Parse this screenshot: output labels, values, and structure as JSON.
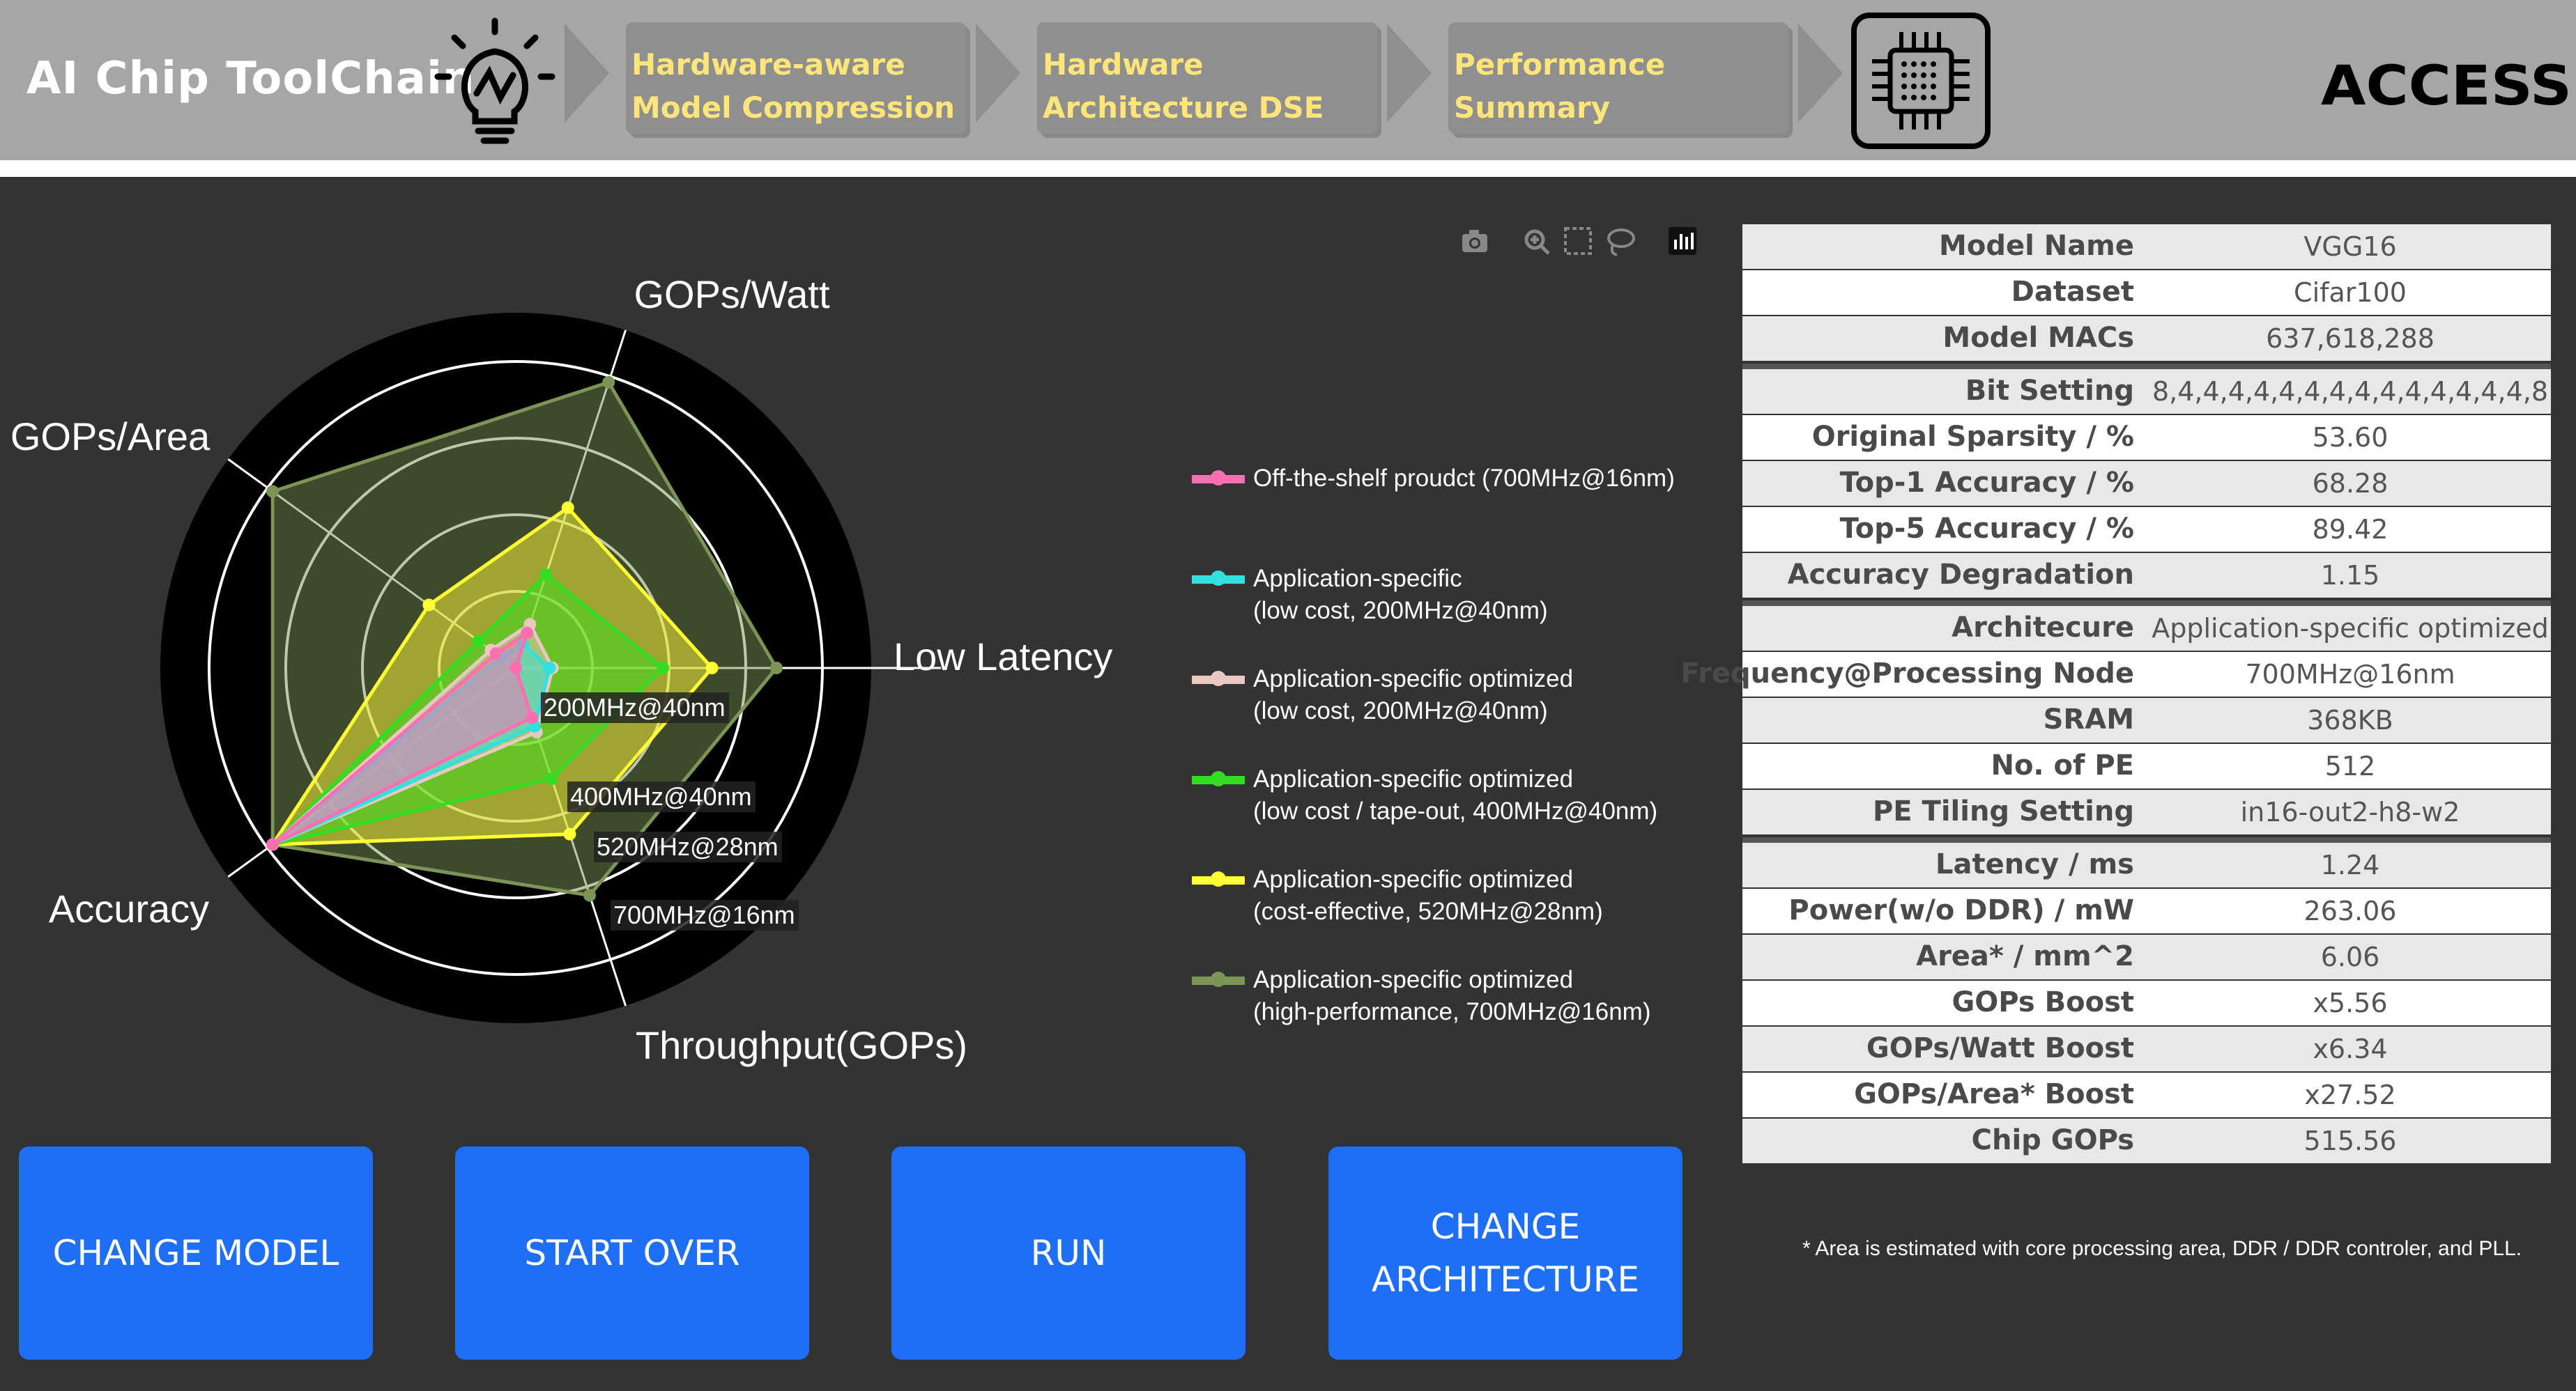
{
  "header": {
    "app_title": "AI Chip ToolChain",
    "steps": [
      {
        "label": "Hardware-aware\nModel Compression"
      },
      {
        "label": "Hardware\nArchitecture DSE"
      },
      {
        "label": "Performance\nSummary"
      }
    ],
    "logo_text": "ACCESS",
    "step_text_color": "#ffe57a"
  },
  "toolbar": {
    "icons": [
      "camera-icon",
      "zoom-icon",
      "box-select-icon",
      "lasso-icon",
      "plotly-logo-icon"
    ]
  },
  "chart_data": {
    "type": "radar",
    "axes": [
      "Low Latency",
      "GOPs/Watt",
      "GOPs/Area",
      "Accuracy",
      "Throughput(GOPs)"
    ],
    "range": [
      0,
      1
    ],
    "grid_levels": [
      0.25,
      0.5,
      0.75,
      1.0
    ],
    "series": [
      {
        "name": "Off-the-shelf proudct (700MHz@16nm)",
        "color": "#ff6fb1",
        "values": [
          0.0,
          0.12,
          0.08,
          0.98,
          0.17
        ]
      },
      {
        "name": "Application-specific\n(low cost, 200MHz@40nm)",
        "color": "#33e0e0",
        "values": [
          0.11,
          0.08,
          0.06,
          0.98,
          0.2
        ]
      },
      {
        "name": "Application-specific optimized\n(low cost, 200MHz@40nm)",
        "color": "#e8c8c0",
        "values": [
          0.12,
          0.15,
          0.1,
          0.98,
          0.22
        ]
      },
      {
        "name": "Application-specific optimized\n(low cost / tape-out, 400MHz@40nm)",
        "color": "#33dd22",
        "values": [
          0.48,
          0.32,
          0.15,
          0.98,
          0.38
        ]
      },
      {
        "name": "Application-specific optimized\n(cost-effective, 520MHz@28nm)",
        "color": "#ffff33",
        "values": [
          0.64,
          0.55,
          0.35,
          0.98,
          0.57
        ]
      },
      {
        "name": "Application-specific optimized\n(high-performance, 700MHz@16nm)",
        "color": "#7d9457",
        "values": [
          0.85,
          0.98,
          0.98,
          0.98,
          0.78
        ]
      }
    ],
    "annotations": [
      "200MHz@40nm",
      "400MHz@40nm",
      "520MHz@28nm",
      "700MHz@16nm"
    ],
    "legend": "right",
    "background": "#000000",
    "grid": true
  },
  "summary": {
    "groups": [
      [
        {
          "label": "Model Name",
          "value": "VGG16"
        },
        {
          "label": "Dataset",
          "value": "Cifar100"
        },
        {
          "label": "Model MACs",
          "value": "637,618,288"
        }
      ],
      [
        {
          "label": "Bit Setting",
          "value": "8,4,4,4,4,4,4,4,4,4,4,4,4,4,4,8"
        },
        {
          "label": "Original Sparsity / %",
          "value": "53.60"
        },
        {
          "label": "Top-1 Accuracy / %",
          "value": "68.28"
        },
        {
          "label": "Top-5 Accuracy / %",
          "value": "89.42"
        },
        {
          "label": "Accuracy Degradation",
          "value": "1.15"
        }
      ],
      [
        {
          "label": "Architecure",
          "value": "Application-specific optimized"
        },
        {
          "label": "Frequency@Processing Node",
          "value": "700MHz@16nm"
        },
        {
          "label": "SRAM",
          "value": "368KB"
        },
        {
          "label": "No. of PE",
          "value": "512"
        },
        {
          "label": "PE Tiling Setting",
          "value": "in16-out2-h8-w2"
        }
      ],
      [
        {
          "label": "Latency / ms",
          "value": "1.24"
        },
        {
          "label": "Power(w/o DDR) / mW",
          "value": "263.06"
        },
        {
          "label": "Area* / mm^2",
          "value": "6.06"
        },
        {
          "label": "GOPs Boost",
          "value": "x5.56"
        },
        {
          "label": "GOPs/Watt Boost",
          "value": "x6.34"
        },
        {
          "label": "GOPs/Area* Boost",
          "value": "x27.52"
        },
        {
          "label": "Chip GOPs",
          "value": "515.56"
        }
      ]
    ]
  },
  "footnote": "* Area is estimated with core processing area, DDR / DDR controler, and PLL.",
  "buttons": {
    "change_model": "CHANGE MODEL",
    "start_over": "START OVER",
    "run": "RUN",
    "change_architecture": "CHANGE\nARCHITECTURE"
  },
  "colors": {
    "background": "#333333",
    "header": "#a6a6a6",
    "button": "#1e6ff5"
  }
}
